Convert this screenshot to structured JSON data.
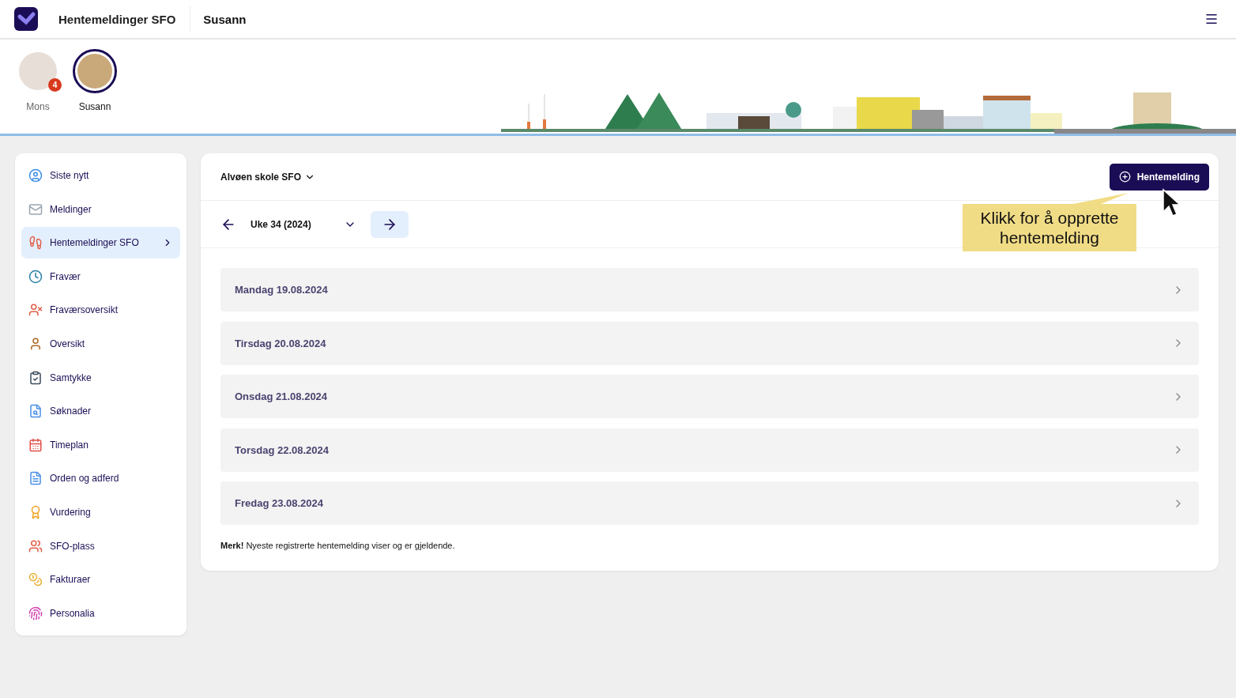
{
  "header": {
    "title": "Hentemeldinger SFO",
    "child": "Susann"
  },
  "children": [
    {
      "name": "Mons",
      "selected": false,
      "badge": "4"
    },
    {
      "name": "Susann",
      "selected": true
    }
  ],
  "sidebar": {
    "items": [
      {
        "label": "Siste nytt",
        "kind": "news",
        "selected": false
      },
      {
        "label": "Meldinger",
        "kind": "mail",
        "selected": false
      },
      {
        "label": "Hentemeldinger SFO",
        "kind": "pickup",
        "selected": true
      },
      {
        "label": "Fravær",
        "kind": "clock",
        "selected": false
      },
      {
        "label": "Fraværsoversikt",
        "kind": "absence",
        "selected": false
      },
      {
        "label": "Oversikt",
        "kind": "person",
        "selected": false
      },
      {
        "label": "Samtykke",
        "kind": "clipboard",
        "selected": false
      },
      {
        "label": "Søknader",
        "kind": "search",
        "selected": false
      },
      {
        "label": "Timeplan",
        "kind": "calendar",
        "selected": false
      },
      {
        "label": "Orden og adferd",
        "kind": "document",
        "selected": false
      },
      {
        "label": "Vurdering",
        "kind": "award",
        "selected": false
      },
      {
        "label": "SFO-plass",
        "kind": "playground",
        "selected": false
      },
      {
        "label": "Fakturaer",
        "kind": "coins",
        "selected": false
      },
      {
        "label": "Personalia",
        "kind": "fingerprint",
        "selected": false
      }
    ]
  },
  "main": {
    "school": "Alvøen skole SFO",
    "new_button": "Hentemelding",
    "week": "Uke 34 (2024)",
    "days": [
      "Mandag 19.08.2024",
      "Tirsdag 20.08.2024",
      "Onsdag 21.08.2024",
      "Torsdag 22.08.2024",
      "Fredag 23.08.2024"
    ],
    "note": "**Merk!** Nyeste registrerte hentemelding viser og er gjeldende."
  },
  "callout": "Klikk for å opprette hentemelding"
}
